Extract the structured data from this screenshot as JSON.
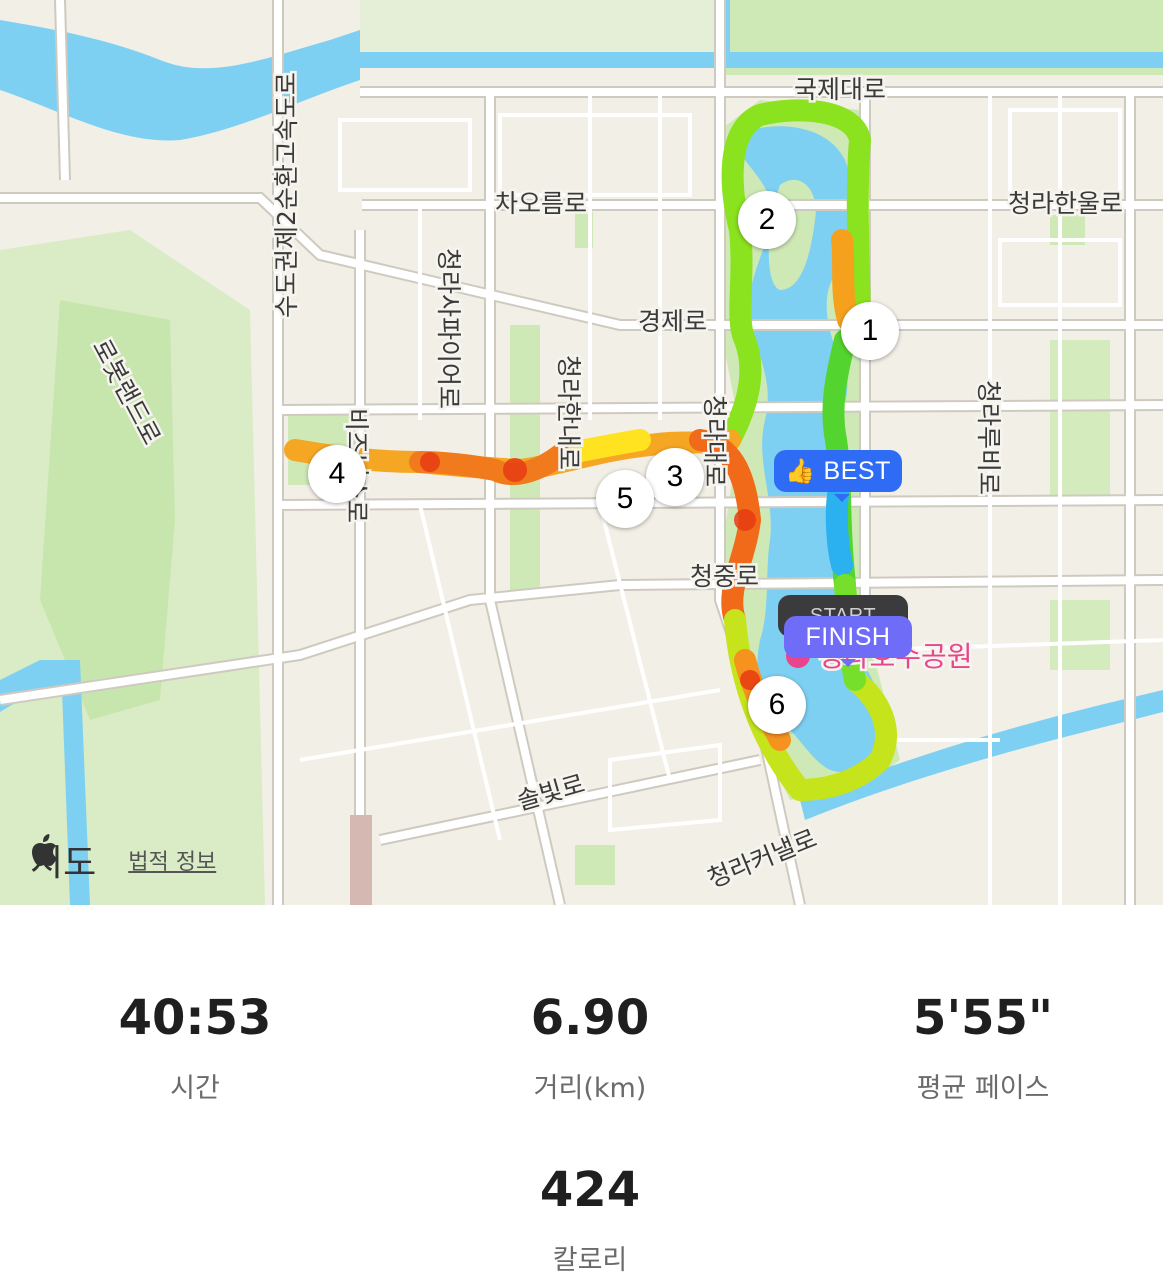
{
  "map": {
    "roads": {
      "gukje": "국제대로",
      "chaoreum": "차오름로",
      "cheongra_hanul": "청라한울로",
      "gyeongje": "경제로",
      "cheongra_rubi": "청라루비로",
      "cheongra_dae": "청라대로",
      "cheongra_hannae": "청라한내로",
      "cheongra_sapphire": "청라사파이어로",
      "biz": "비즈니스로",
      "capital_ring": "수도권제2순환고속도로",
      "robotland": "로봇랜드로",
      "cheongjung": "청중로",
      "solbit": "솔빛로",
      "cheongra_canal": "청라커낼로"
    },
    "poi": "청라호수공원",
    "markers": [
      "1",
      "2",
      "3",
      "4",
      "5",
      "6"
    ],
    "best_label": "BEST",
    "start_label": "START",
    "finish_label": "FINISH",
    "maps_brand": "지도",
    "legal_link": "법적 정보",
    "colors": {
      "water": "#7ed0f2",
      "park": "#cfe9b6",
      "road": "#ffffff",
      "best": "#2e6cf5",
      "finish": "#6f6cf7",
      "poi": "#e8458c"
    }
  },
  "stats": {
    "time": {
      "value": "40:53",
      "label": "시간"
    },
    "distance": {
      "value": "6.90",
      "label": "거리(km)"
    },
    "pace": {
      "value": "5'55\"",
      "label": "평균 페이스"
    },
    "calories": {
      "value": "424",
      "label": "칼로리"
    }
  }
}
